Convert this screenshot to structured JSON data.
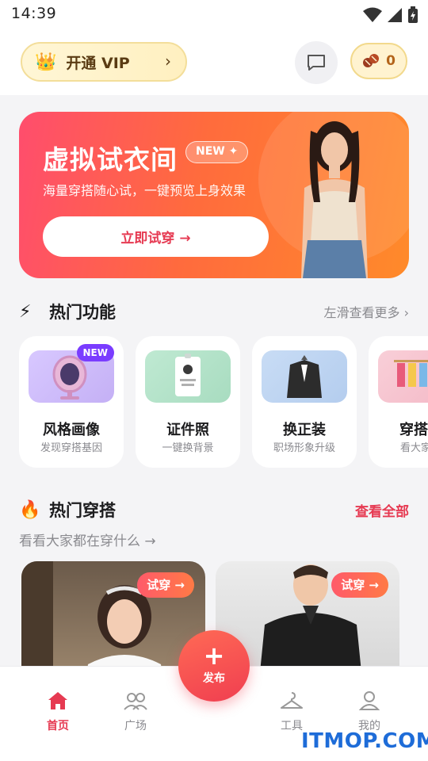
{
  "status": {
    "time": "14:39"
  },
  "topbar": {
    "vip_label": "开通 VIP",
    "coin_count": "0"
  },
  "banner": {
    "title": "虚拟试衣间",
    "new_tag": "NEW ✦",
    "subtitle": "海量穿搭随心试，一键预览上身效果",
    "cta": "立即试穿 →"
  },
  "hot_features": {
    "title": "热门功能",
    "more": "左滑查看更多",
    "items": [
      {
        "name": "风格画像",
        "desc": "发现穿搭基因",
        "badge": "NEW"
      },
      {
        "name": "证件照",
        "desc": "一键换背景"
      },
      {
        "name": "换正装",
        "desc": "职场形象升级"
      },
      {
        "name": "穿搭广",
        "desc": "看大家都"
      }
    ]
  },
  "hot_outfits": {
    "title": "热门穿搭",
    "view_all": "查看全部",
    "subtitle": "看看大家都在穿什么 →",
    "try_label": "试穿 →"
  },
  "tabbar": {
    "home": "首页",
    "square": "广场",
    "publish": "发布",
    "tools": "工具",
    "mine": "我的"
  },
  "watermark": "ITMOP.COM",
  "colors": {
    "accent": "#e63a52",
    "banner_start": "#ff4d6d",
    "banner_end": "#ff8a2a"
  }
}
